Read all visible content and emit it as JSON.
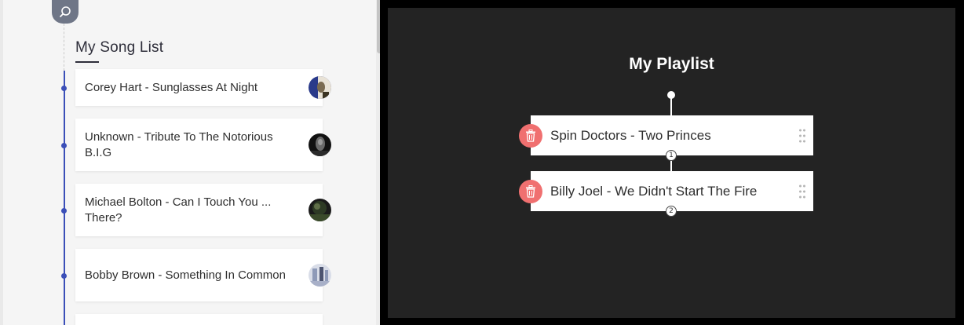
{
  "song_list": {
    "title": "My Song List",
    "search_icon": "search-icon",
    "items": [
      {
        "label": "Corey Hart - Sunglasses At Night",
        "thumb_colors": [
          "#2a3a8a",
          "#e8e2d6",
          "#7a6a50"
        ]
      },
      {
        "label": "Unknown - Tribute To The Notorious B.I.G",
        "thumb_colors": [
          "#111111",
          "#6a6a6a",
          "#2b2b2b"
        ]
      },
      {
        "label": "Michael Bolton - Can I Touch You ... There?",
        "thumb_colors": [
          "#2d3a24",
          "#5f6e48",
          "#1a1a1a"
        ]
      },
      {
        "label": "Bobby Brown - Something In Common",
        "thumb_colors": [
          "#8e9ab8",
          "#d9dde8",
          "#4c5470"
        ]
      }
    ]
  },
  "playlist": {
    "title": "My Playlist",
    "tracks": [
      {
        "label": "Spin Doctors - Two Princes",
        "order": "1"
      },
      {
        "label": "Billy Joel - We Didn't Start The Fire",
        "order": "2"
      }
    ],
    "delete_icon": "trash-icon",
    "drag_icon": "drag-handle-icon"
  },
  "colors": {
    "timeline": "#3b4fb8",
    "delete": "#f07070",
    "panel_dark": "#232323"
  }
}
